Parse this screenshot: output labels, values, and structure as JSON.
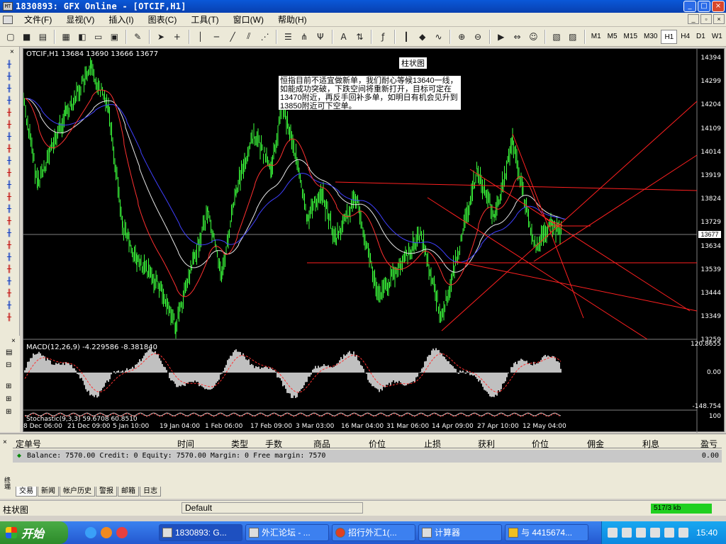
{
  "window": {
    "title": "1830893: GFX Online - [OTCIF,H1]",
    "buttons": [
      "_",
      "□",
      "×"
    ]
  },
  "menu": {
    "items": [
      "文件(F)",
      "显视(V)",
      "插入(I)",
      "图表(C)",
      "工具(T)",
      "窗口(W)",
      "帮助(H)"
    ]
  },
  "toolbar": {
    "timeframes": [
      "M1",
      "M5",
      "M15",
      "M30",
      "H1",
      "H4",
      "D1",
      "W1"
    ],
    "active_timeframe": "H1"
  },
  "chart": {
    "info": "OTCIF,H1  13684 13690 13666 13677",
    "type_label": "柱状图",
    "note": "恒指目前不适宜做新单，我们耐心等候13640一线，如能成功突破，下跌空间将重新打开，目标可定在13470附近，再反手回补多单，如明日有机会见升到13850附近可下空单。",
    "price_axis": [
      "14394",
      "14299",
      "14204",
      "14109",
      "14014",
      "13919",
      "13824",
      "13729",
      "13634",
      "13539",
      "13444",
      "13349",
      "13259"
    ],
    "current_price": "13677",
    "macd_info": "MACD(12,26,9)  -4.229586  -8.381840",
    "macd_axis": [
      "120.8655",
      "0.00",
      "-148.754"
    ],
    "stoch_info": "Stochastic(9,3,3)  59.6708  60.8510",
    "stoch_axis": [
      "100"
    ],
    "dates": [
      "8 Dec 06:00",
      "21 Dec 09:00",
      "5 Jan 10:00",
      "19 Jan 04:00",
      "1 Feb 06:00",
      "17 Feb 09:00",
      "3 Mar 03:00",
      "16 Mar 04:00",
      "31 Mar 06:00",
      "14 Apr 09:00",
      "27 Apr 10:00",
      "12 May 04:00"
    ]
  },
  "terminal": {
    "columns": [
      "定单号",
      "时间",
      "类型",
      "手数",
      "商品",
      "价位",
      "止损",
      "获利",
      "价位",
      "佣金",
      "利息",
      "盈亏"
    ],
    "balance_row": "Balance: 7570.00   Credit: 0   Equity: 7570.00   Margin: 0  Free margin: 7570",
    "profit": "0.00",
    "tabs": [
      "交易",
      "新闻",
      "帐户历史",
      "警报",
      "邮箱",
      "日志"
    ],
    "side_label": "终端"
  },
  "status": {
    "left": "柱状图",
    "profile": "Default",
    "connection": "517/3 kb"
  },
  "taskbar": {
    "start": "开始",
    "tasks": [
      "1830893: G...",
      "外汇论坛 - ...",
      "招行外汇1(...",
      "计算器",
      "与 4415674..."
    ],
    "clock": "15:40"
  }
}
